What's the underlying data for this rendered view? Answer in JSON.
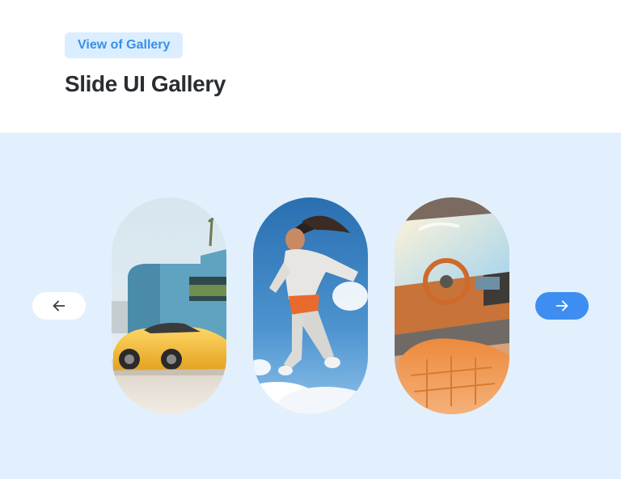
{
  "header": {
    "badge_label": "View of Gallery",
    "title": "Slide UI Gallery"
  },
  "carousel": {
    "prev_icon": "arrow-left-icon",
    "next_icon": "arrow-right-icon",
    "slides": [
      {
        "subject": "yellow sports car in front of modern blue building"
      },
      {
        "subject": "woman jumping in the sky among clouds"
      },
      {
        "subject": "car interior with orange leather seats"
      }
    ]
  },
  "colors": {
    "badge_bg": "#dbeeff",
    "badge_text": "#3a8ee8",
    "stage_bg": "#e2f0fd",
    "accent": "#3d8ef0"
  }
}
